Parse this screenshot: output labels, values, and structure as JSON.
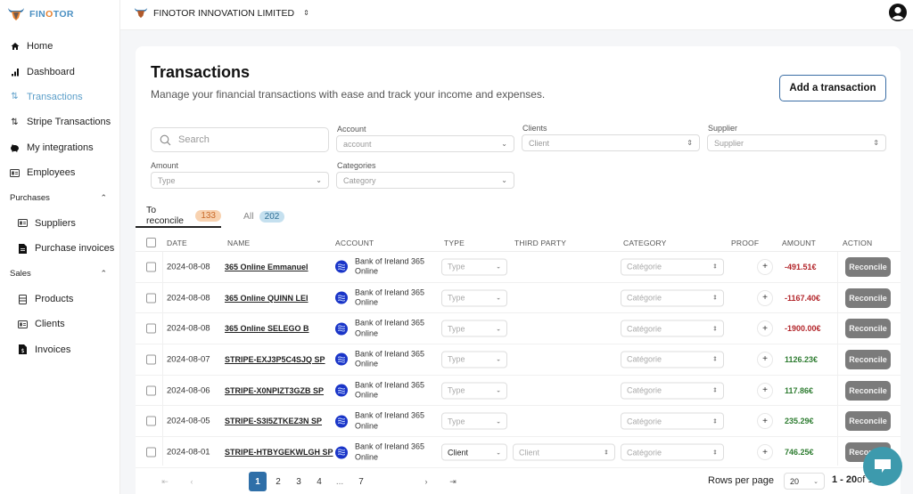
{
  "brand": {
    "name_part1": "FIN",
    "name_part2": "O",
    "name_part3": "TOR",
    "logo_icon": "bull-head-icon",
    "primary_color": "#4a8fc2",
    "accent_color": "#e8822f"
  },
  "sidebar": {
    "items": [
      {
        "label": "Home",
        "icon": "home-icon",
        "active": false
      },
      {
        "label": "Dashboard",
        "icon": "bar-chart-icon",
        "active": false
      },
      {
        "label": "Transactions",
        "icon": "arrows-updown-icon",
        "active": true
      },
      {
        "label": "Stripe Transactions",
        "icon": "arrows-updown-icon",
        "active": false
      },
      {
        "label": "My integrations",
        "icon": "piggy-bank-icon",
        "active": false
      },
      {
        "label": "Employees",
        "icon": "id-card-icon",
        "active": false
      }
    ],
    "sections": [
      {
        "label": "Purchases",
        "expanded": true,
        "items": [
          {
            "label": "Suppliers",
            "icon": "id-card-icon"
          },
          {
            "label": "Purchase invoices",
            "icon": "document-icon"
          }
        ]
      },
      {
        "label": "Sales",
        "expanded": true,
        "items": [
          {
            "label": "Products",
            "icon": "list-icon"
          },
          {
            "label": "Clients",
            "icon": "id-card-icon"
          },
          {
            "label": "Invoices",
            "icon": "invoice-icon"
          }
        ]
      }
    ]
  },
  "topbar": {
    "org_name": "FINOTOR INNOVATION LIMITED",
    "user_icon": "user-circle-icon"
  },
  "page": {
    "title": "Transactions",
    "subtitle": "Manage your financial transactions with ease and track your income and expenses.",
    "add_button": "Add a transaction"
  },
  "filters": {
    "search_placeholder": "Search",
    "account": {
      "label": "Account",
      "placeholder": "account"
    },
    "clients": {
      "label": "Clients",
      "placeholder": "Client"
    },
    "supplier": {
      "label": "Supplier",
      "placeholder": "Supplier"
    },
    "amount": {
      "label": "Amount",
      "placeholder": "Type"
    },
    "categories": {
      "label": "Categories",
      "placeholder": "Category"
    }
  },
  "tabs": [
    {
      "label": "To reconcile",
      "count": "133",
      "active": true
    },
    {
      "label": "All",
      "count": "202",
      "active": false
    }
  ],
  "table": {
    "columns": [
      "DATE",
      "NAME",
      "ACCOUNT",
      "TYPE",
      "THIRD PARTY",
      "CATEGORY",
      "PROOF",
      "AMOUNT",
      "ACTION"
    ],
    "rows": [
      {
        "date": "2024-08-08",
        "name": "365 Online Emmanuel",
        "account": "Bank of Ireland 365 Online",
        "type": "Type",
        "type_set": false,
        "third_party": "",
        "category": "Catégorie",
        "proof": "+",
        "amount": "-491.51€",
        "sign": "neg",
        "action": "Reconcile"
      },
      {
        "date": "2024-08-08",
        "name": "365 Online QUINN LEI",
        "account": "Bank of Ireland 365 Online",
        "type": "Type",
        "type_set": false,
        "third_party": "",
        "category": "Catégorie",
        "proof": "+",
        "amount": "-1167.40€",
        "sign": "neg",
        "action": "Reconcile"
      },
      {
        "date": "2024-08-08",
        "name": "365 Online SELEGO B",
        "account": "Bank of Ireland 365 Online",
        "type": "Type",
        "type_set": false,
        "third_party": "",
        "category": "Catégorie",
        "proof": "+",
        "amount": "-1900.00€",
        "sign": "neg",
        "action": "Reconcile"
      },
      {
        "date": "2024-08-07",
        "name": "STRIPE-EXJ3P5C4SJQ SP",
        "account": "Bank of Ireland 365 Online",
        "type": "Type",
        "type_set": false,
        "third_party": "",
        "category": "Catégorie",
        "proof": "+",
        "amount": "1126.23€",
        "sign": "pos",
        "action": "Reconcile"
      },
      {
        "date": "2024-08-06",
        "name": "STRIPE-X0NPIZT3GZB SP",
        "account": "Bank of Ireland 365 Online",
        "type": "Type",
        "type_set": false,
        "third_party": "",
        "category": "Catégorie",
        "proof": "+",
        "amount": "117.86€",
        "sign": "pos",
        "action": "Reconcile"
      },
      {
        "date": "2024-08-05",
        "name": "STRIPE-S3I5ZTKEZ3N SP",
        "account": "Bank of Ireland 365 Online",
        "type": "Type",
        "type_set": false,
        "third_party": "",
        "category": "Catégorie",
        "proof": "+",
        "amount": "235.29€",
        "sign": "pos",
        "action": "Reconcile"
      },
      {
        "date": "2024-08-01",
        "name": "STRIPE-HTBYGEKWLGH SP",
        "account": "Bank of Ireland 365 Online",
        "type": "Client",
        "type_set": true,
        "third_party": "Client",
        "category": "Catégorie",
        "proof": "+",
        "amount": "746.25€",
        "sign": "pos",
        "action": "Reconcile"
      }
    ]
  },
  "pagination": {
    "first": "⇤",
    "prev": "‹",
    "next": "›",
    "last": "⇥",
    "pages": [
      "1",
      "2",
      "3",
      "4",
      "...",
      "7"
    ],
    "current": "1",
    "rows_per_page_label": "Rows per page",
    "rows_per_page": "20",
    "range_bold": "1 - 20",
    "range_rest": "of 133"
  },
  "chat": {
    "icon": "chat-bubble-icon"
  },
  "colors": {
    "negative": "#b3262b",
    "positive": "#2f7d32",
    "reconcile_button": "#7b7b7b",
    "page_active": "#2f6fa8",
    "chat": "#3d9aad"
  }
}
